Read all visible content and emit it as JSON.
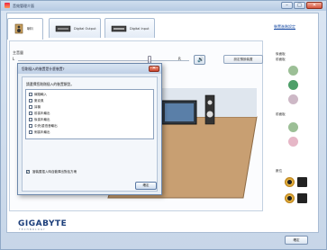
{
  "window": {
    "title": "音效管理介面",
    "minimize": "–",
    "maximize": "□",
    "close": "✕"
  },
  "tabs": [
    {
      "label": "喇叭",
      "icon": "speaker-icon"
    },
    {
      "label": "Digital Output",
      "icon": "digital-output-icon"
    },
    {
      "label": "Digital Input",
      "icon": "digital-input-icon"
    }
  ],
  "top_link": "裝置進階設定",
  "volume": {
    "label": "主音量",
    "left": "L",
    "right": "R",
    "level": 0.78
  },
  "default_button": "設定預設裝置",
  "side": {
    "rear_label": "後面板",
    "rear_sub": "前面板",
    "front_label": "前面板",
    "digital_label": "數位"
  },
  "footer": {
    "brand": "GIGABYTE",
    "sub": "TECHNOLOGY",
    "ok": "確定"
  },
  "dialog": {
    "title": "您剛插入的裝置是什麼裝置?",
    "close": "✕",
    "prompt": "請選擇您剛剛插入的裝置類型。",
    "options": [
      "線路輸入",
      "麥克風",
      "耳機",
      "前喪叭輸出",
      "後喪叭輸出",
      "中央/重低音輸出",
      "側喪叭輸出"
    ],
    "auto_popup": "當裝置插入時自動彈出對話方塊",
    "ok": "確定"
  }
}
